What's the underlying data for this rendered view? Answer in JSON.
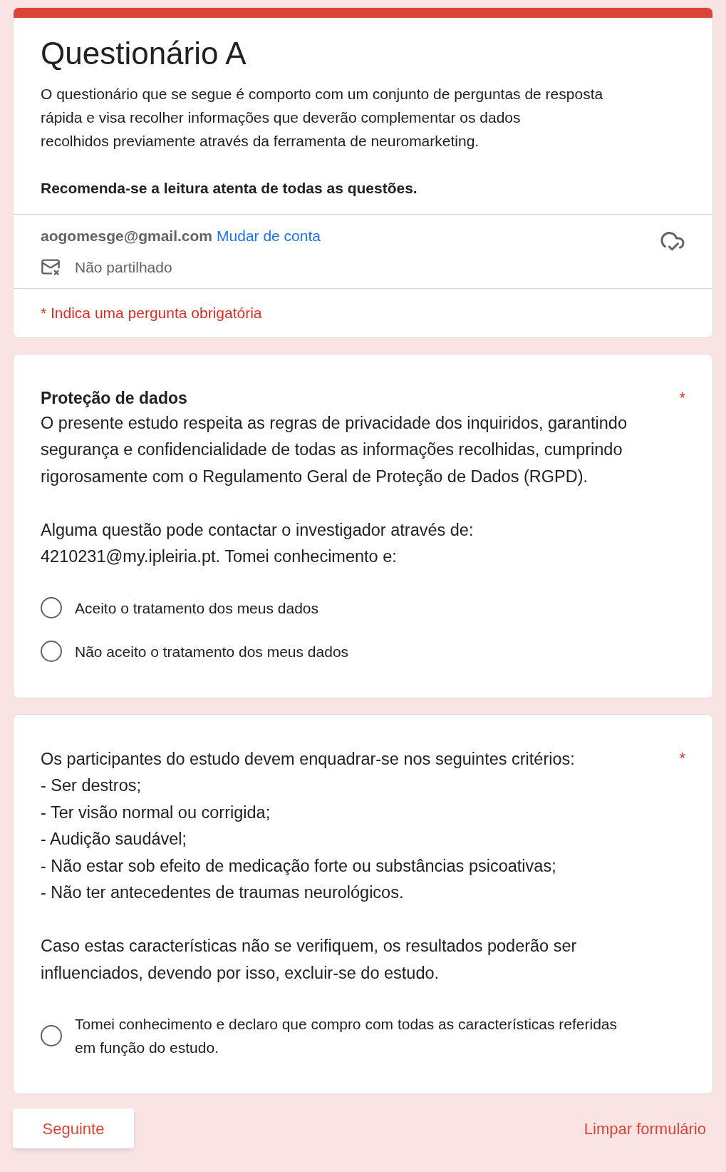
{
  "header": {
    "title": "Questionário A",
    "description": "O questionário que se segue é comporto com um conjunto de perguntas de resposta\nrápida e visa recolher informações que deverão complementar os dados\nrecolhidos previamente através da ferramenta de neuromarketing.",
    "notice": "Recomenda-se a leitura atenta de todas as questões."
  },
  "account": {
    "email": "aogomesge@gmail.com",
    "switch_link": "Mudar de conta",
    "sharing": "Não partilhado"
  },
  "required_note": "* Indica uma pergunta obrigatória",
  "questions": [
    {
      "title": "Proteção de dados",
      "required": true,
      "asterisk": "*",
      "description": "O presente estudo respeita as regras de privacidade dos inquiridos, garantindo\nsegurança e confidencialidade de todas as informações recolhidas, cumprindo\nrigorosamente com o Regulamento Geral de Proteção de Dados (RGPD).\n\nAlguma questão pode contactar o investigador através de:\n4210231@my.ipleiria.pt. Tomei conhecimento e:",
      "options": [
        {
          "label": "Aceito o tratamento dos meus dados",
          "selected": false
        },
        {
          "label": "Não aceito o tratamento dos meus dados",
          "selected": false
        }
      ]
    },
    {
      "required": true,
      "asterisk": "*",
      "description": "Os participantes do estudo devem enquadrar-se nos seguintes critérios:\n- Ser destros;\n- Ter visão normal ou corrigida;\n- Audição saudável;\n- Não estar sob efeito de medicação forte ou substâncias psicoativas;\n- Não ter antecedentes de traumas neurológicos.\n\nCaso estas características não se verifiquem, os resultados poderão ser\ninfluenciados, devendo por isso, excluir-se do estudo.",
      "options": [
        {
          "label": "Tomei conhecimento e declaro que compro com todas as características referidas\nem função do estudo.",
          "selected": false
        }
      ]
    }
  ],
  "footer": {
    "next_button": "Seguinte",
    "clear_link": "Limpar formulário"
  }
}
